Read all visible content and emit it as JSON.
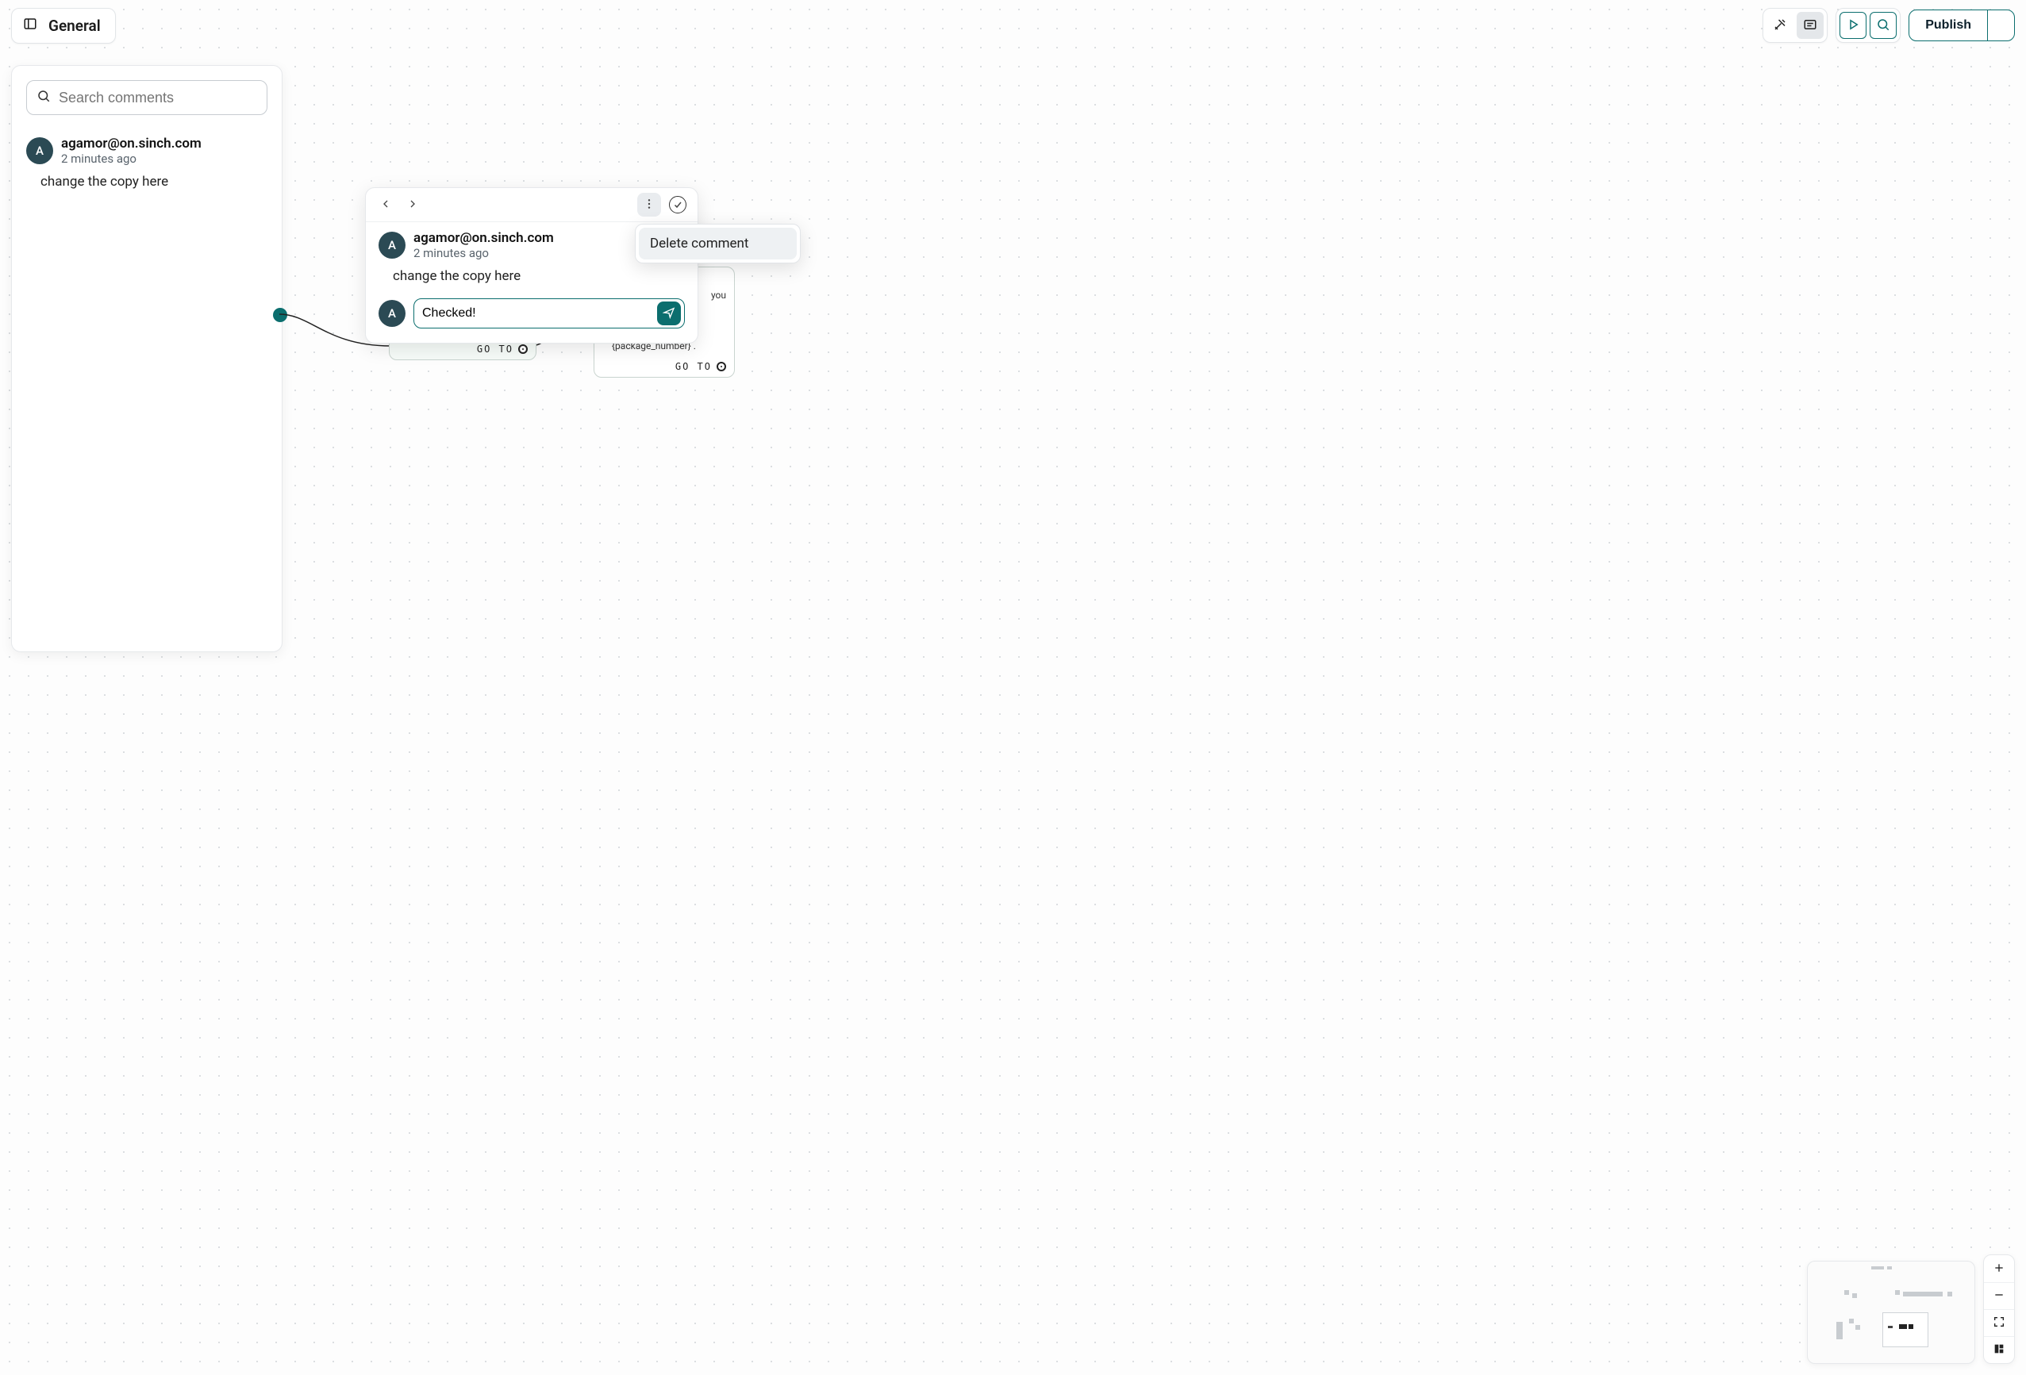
{
  "page": {
    "title": "General"
  },
  "toolbar": {
    "publish_label": "Publish"
  },
  "search": {
    "placeholder": "Search comments"
  },
  "sidebar_comment": {
    "avatar_initial": "A",
    "user": "agamor@on.sinch.com",
    "time": "2 minutes ago",
    "body": "change the copy here"
  },
  "popup_comment": {
    "avatar_initial": "A",
    "user": "agamor@on.sinch.com",
    "time": "2 minutes ago",
    "body": "change the copy here",
    "reply_avatar_initial": "A",
    "reply_value": "Checked!"
  },
  "context_menu": {
    "delete_label": "Delete comment"
  },
  "canvas": {
    "goto_label": "GO TO",
    "nodeB_line1": "you",
    "nodeB_line2": "{package_number} ."
  }
}
